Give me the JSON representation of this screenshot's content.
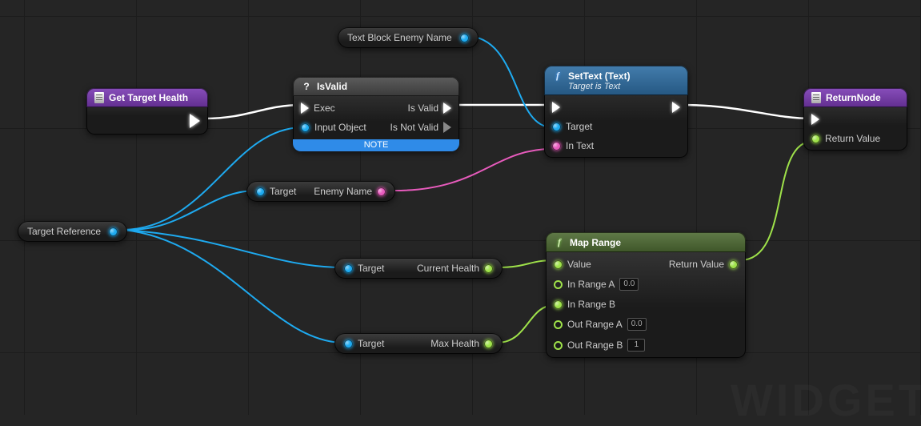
{
  "get_target_health": {
    "title": "Get Target Health"
  },
  "tb_enemy": {
    "label": "Text Block Enemy Name"
  },
  "isvalid": {
    "title": "IsValid",
    "in_exec": "Exec",
    "in_obj": "Input Object",
    "out_valid": "Is Valid",
    "out_invalid": "Is Not Valid",
    "note": "NOTE"
  },
  "settext": {
    "title": "SetText (Text)",
    "subtitle": "Target is Text",
    "in_target": "Target",
    "in_text": "In Text"
  },
  "return_node": {
    "title": "ReturnNode",
    "out": "Return Value"
  },
  "target_ref": {
    "label": "Target Reference"
  },
  "enemy_name": {
    "in": "Target",
    "out": "Enemy Name"
  },
  "cur_health": {
    "in": "Target",
    "out": "Current Health"
  },
  "max_health": {
    "in": "Target",
    "out": "Max Health"
  },
  "maprange": {
    "title": "Map Range",
    "in_value": "Value",
    "in_a": "In Range A",
    "in_a_val": "0.0",
    "in_b": "In Range B",
    "out_a": "Out Range A",
    "out_a_val": "0.0",
    "out_b": "Out Range B",
    "out_b_val": "1",
    "return": "Return Value"
  },
  "watermark": "WIDGET"
}
